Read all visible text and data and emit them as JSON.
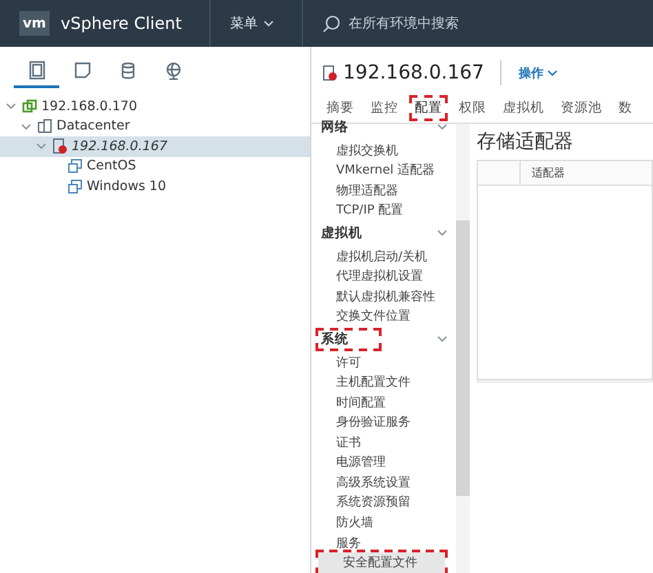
{
  "header": {
    "logo": "vm",
    "product": "vSphere Client",
    "menu": "菜单",
    "search_placeholder": "在所有环境中搜索"
  },
  "navigator_tabs": [
    {
      "kind": "hosts",
      "selected": true
    },
    {
      "kind": "vms",
      "selected": false
    },
    {
      "kind": "storage",
      "selected": false
    },
    {
      "kind": "network",
      "selected": false
    }
  ],
  "tree": [
    {
      "label": "192.168.0.170",
      "kind": "vcenter",
      "expanded": true,
      "selected": false,
      "children": [
        {
          "label": "Datacenter",
          "kind": "datacenter",
          "expanded": true,
          "selected": false,
          "children": [
            {
              "label": "192.168.0.167",
              "kind": "host",
              "expanded": true,
              "selected": true,
              "children": [
                {
                  "label": "CentOS",
                  "kind": "vm",
                  "selected": false
                },
                {
                  "label": "Windows 10",
                  "kind": "vm",
                  "selected": false
                }
              ]
            }
          ]
        }
      ]
    }
  ],
  "object": {
    "title": "192.168.0.167",
    "actions": "操作",
    "tabs": [
      {
        "label": "摘要",
        "selected": false,
        "highlighted": false
      },
      {
        "label": "监控",
        "selected": false,
        "highlighted": false
      },
      {
        "label": "配置",
        "selected": true,
        "highlighted": true
      },
      {
        "label": "权限",
        "selected": false,
        "highlighted": false
      },
      {
        "label": "虚拟机",
        "selected": false,
        "highlighted": false
      },
      {
        "label": "资源池",
        "selected": false,
        "highlighted": false
      },
      {
        "label": "数",
        "selected": false,
        "highlighted": false
      }
    ]
  },
  "config_nav": [
    {
      "title": "网络",
      "highlighted": false,
      "items": [
        {
          "label": "虚拟交换机",
          "selected": false,
          "highlighted": false
        },
        {
          "label": "VMkernel 适配器",
          "selected": false,
          "highlighted": false
        },
        {
          "label": "物理适配器",
          "selected": false,
          "highlighted": false
        },
        {
          "label": "TCP/IP 配置",
          "selected": false,
          "highlighted": false
        }
      ]
    },
    {
      "title": "虚拟机",
      "highlighted": false,
      "items": [
        {
          "label": "虚拟机启动/关机",
          "selected": false,
          "highlighted": false
        },
        {
          "label": "代理虚拟机设置",
          "selected": false,
          "highlighted": false
        },
        {
          "label": "默认虚拟机兼容性",
          "selected": false,
          "highlighted": false
        },
        {
          "label": "交换文件位置",
          "selected": false,
          "highlighted": false
        }
      ]
    },
    {
      "title": "系统",
      "highlighted": true,
      "items": [
        {
          "label": "许可",
          "selected": false,
          "highlighted": false
        },
        {
          "label": "主机配置文件",
          "selected": false,
          "highlighted": false
        },
        {
          "label": "时间配置",
          "selected": false,
          "highlighted": false
        },
        {
          "label": "身份验证服务",
          "selected": false,
          "highlighted": false
        },
        {
          "label": "证书",
          "selected": false,
          "highlighted": false
        },
        {
          "label": "电源管理",
          "selected": false,
          "highlighted": false
        },
        {
          "label": "高级系统设置",
          "selected": false,
          "highlighted": false
        },
        {
          "label": "系统资源预留",
          "selected": false,
          "highlighted": false
        },
        {
          "label": "防火墙",
          "selected": false,
          "highlighted": false
        },
        {
          "label": "服务",
          "selected": false,
          "highlighted": false
        },
        {
          "label": "安全配置文件",
          "selected": true,
          "highlighted": true
        }
      ]
    }
  ],
  "content": {
    "title": "存储适配器",
    "table": {
      "columns": [
        "适配器"
      ]
    }
  }
}
